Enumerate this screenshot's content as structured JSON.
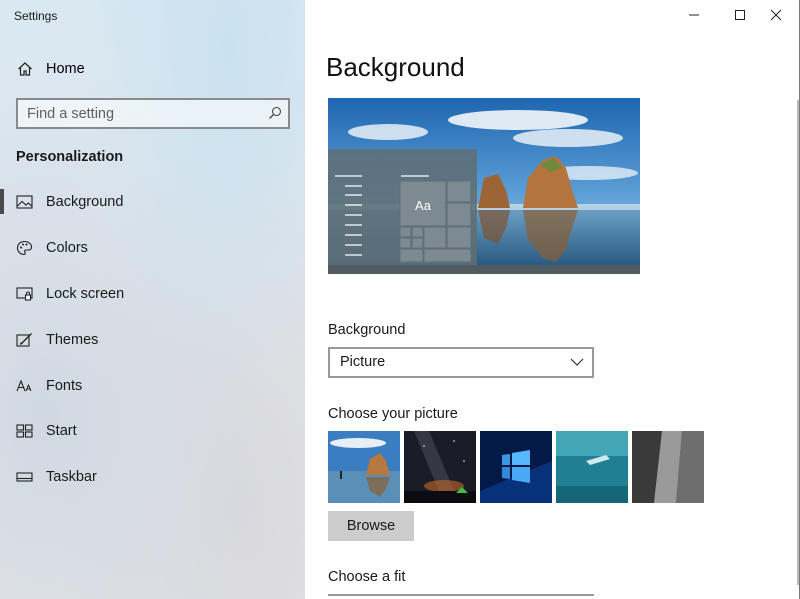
{
  "window": {
    "title": "Settings"
  },
  "sidebar": {
    "home_label": "Home",
    "search_placeholder": "Find a setting",
    "section_title": "Personalization",
    "items": [
      {
        "label": "Background",
        "icon": "picture-icon",
        "selected": true
      },
      {
        "label": "Colors",
        "icon": "palette-icon",
        "selected": false
      },
      {
        "label": "Lock screen",
        "icon": "lock-screen-icon",
        "selected": false
      },
      {
        "label": "Themes",
        "icon": "brush-icon",
        "selected": false
      },
      {
        "label": "Fonts",
        "icon": "font-icon",
        "selected": false
      },
      {
        "label": "Start",
        "icon": "start-tiles-icon",
        "selected": false
      },
      {
        "label": "Taskbar",
        "icon": "taskbar-icon",
        "selected": false
      }
    ]
  },
  "main": {
    "page_title": "Background",
    "preview": {
      "sample_text": "Aa"
    },
    "background_label": "Background",
    "background_value": "Picture",
    "choose_picture_label": "Choose your picture",
    "pictures": [
      "beach-rocks",
      "milky-way-tent",
      "windows-logo-blue",
      "underwater-swimmer",
      "rock-face"
    ],
    "browse_label": "Browse",
    "choose_fit_label": "Choose a fit"
  },
  "colors": {
    "accent": "#4a4a4a",
    "sidebar_bg": "#dfe7ee",
    "button_bg": "#cccccc"
  }
}
